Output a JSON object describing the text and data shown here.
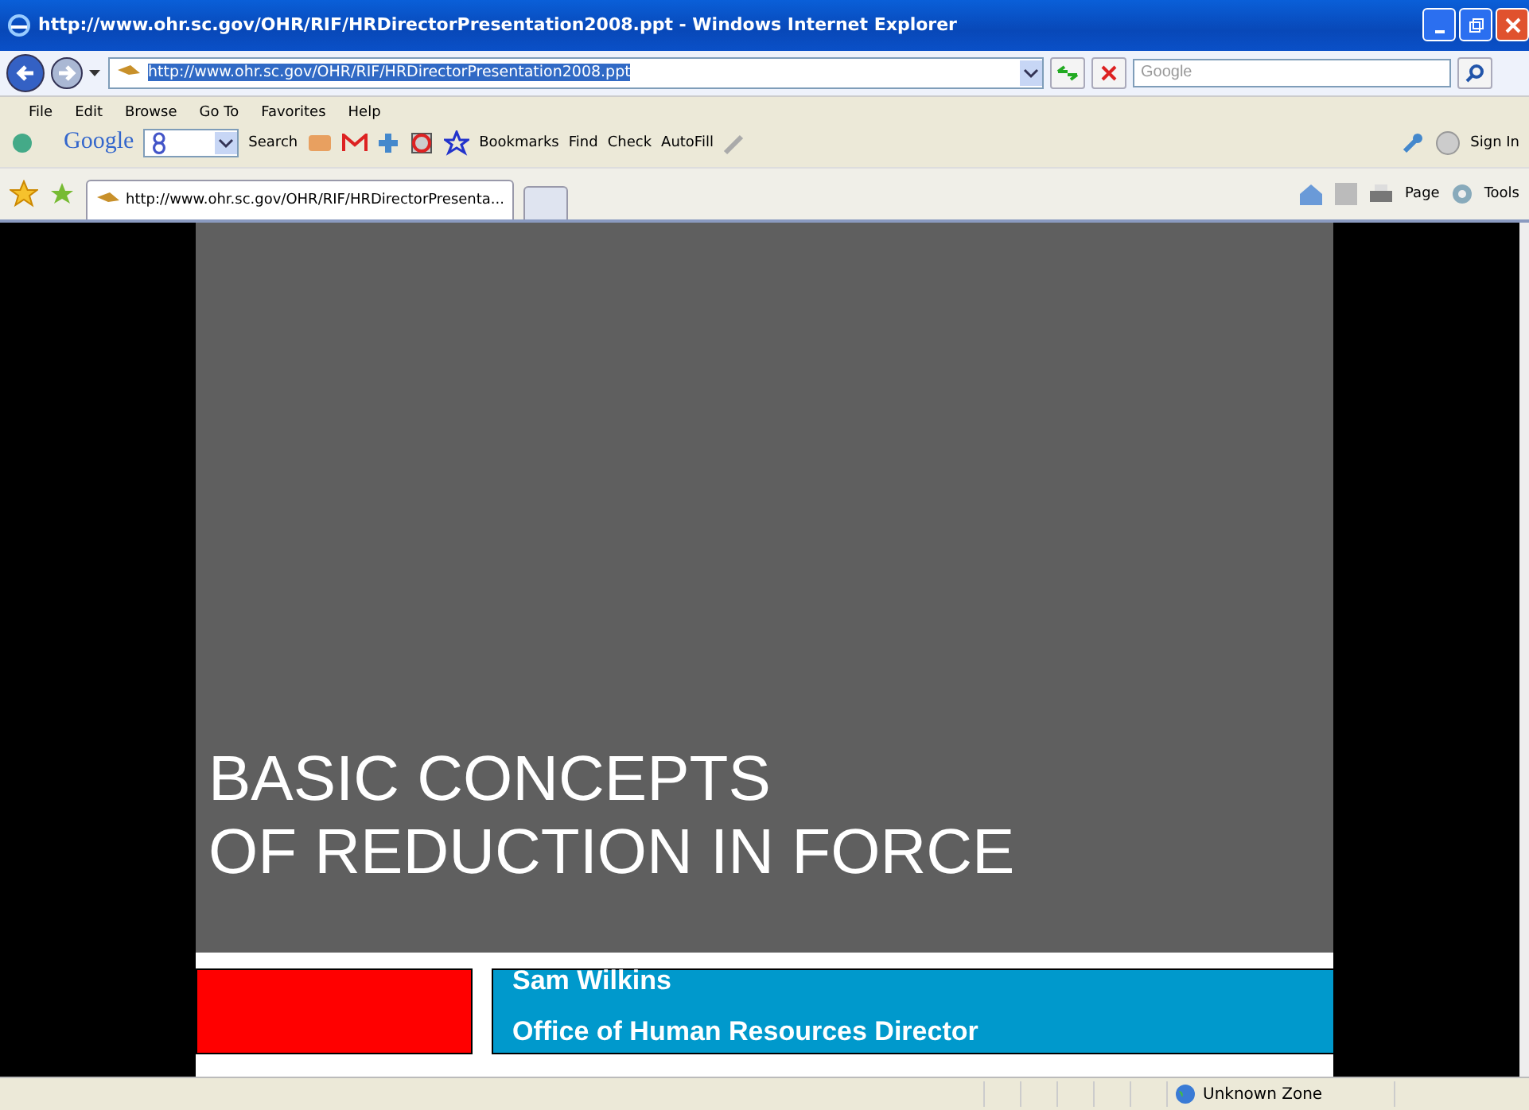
{
  "window": {
    "title": "http://www.ohr.sc.gov/OHR/RIF/HRDirectorPresentation2008.ppt - Windows Internet Explorer"
  },
  "address_bar": {
    "value": "http://www.ohr.sc.gov/OHR/RIF/HRDirectorPresentation2008.ppt"
  },
  "search": {
    "placeholder": "Google"
  },
  "menu": [
    "File",
    "Edit",
    "Browse",
    "Go To",
    "Favorites",
    "Help"
  ],
  "toolbar": {
    "google": "Google",
    "search": "Search",
    "bookmarks": "Bookmarks",
    "find": "Find",
    "check": "Check",
    "autofill": "AutoFill",
    "sign_in": "Sign In"
  },
  "tabs": [
    {
      "label": "http://www.ohr.sc.gov/OHR/RIF/HRDirectorPresenta...",
      "selected": true
    }
  ],
  "command_bar": {
    "page": "Page",
    "tools": "Tools"
  },
  "slide": {
    "title_lines": [
      "BASIC CONCEPTS",
      "OF REDUCTION IN FORCE"
    ],
    "presenter": "Sam Wilkins",
    "role": "Office of Human Resources Director"
  },
  "status_bar": {
    "zone": "Unknown Zone"
  }
}
